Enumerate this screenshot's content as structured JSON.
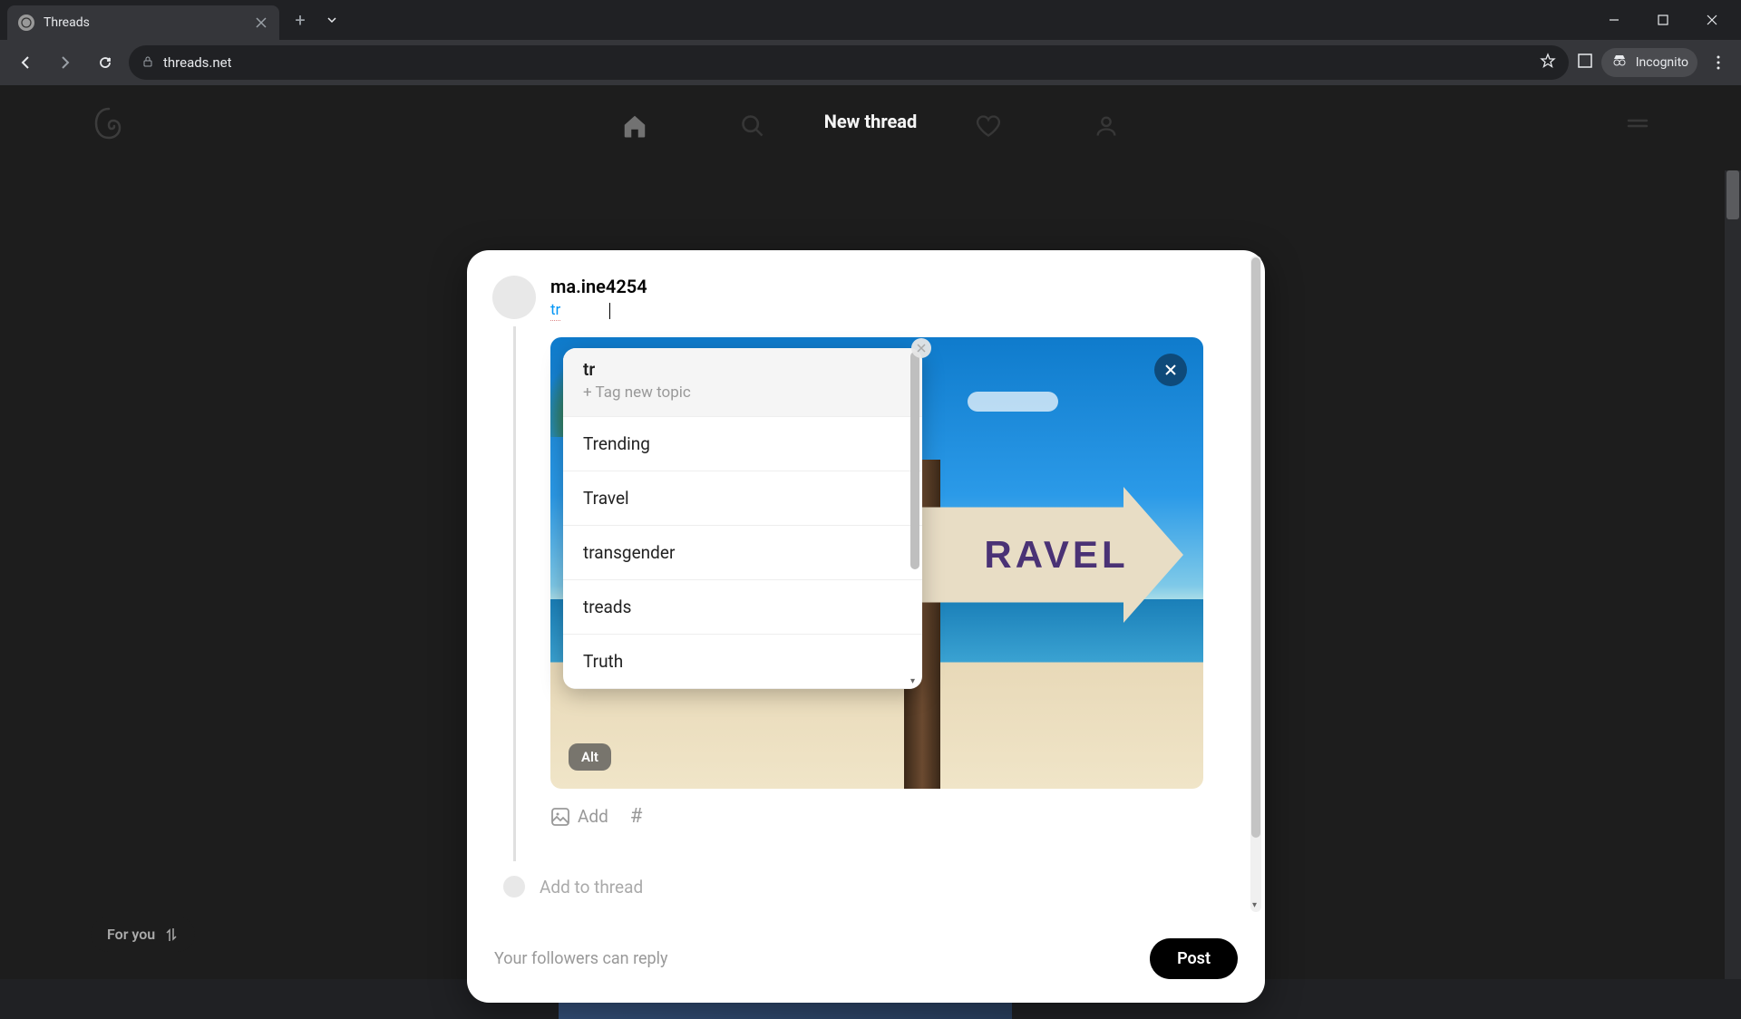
{
  "browser": {
    "tab_title": "Threads",
    "url": "threads.net",
    "incognito_label": "Incognito"
  },
  "threads_nav": {
    "modal_title": "New thread",
    "feed_pill": "For you"
  },
  "compose": {
    "username": "ma.ine4254",
    "typed_tag": "tr",
    "alt_label": "Alt",
    "add_label": "Add",
    "hash_label": "#",
    "add_to_thread": "Add to thread",
    "reply_setting": "Your followers can reply",
    "post_button": "Post",
    "image_sign_text": "RAVEL"
  },
  "topic_dropdown": {
    "query": "tr",
    "tag_new_label": "+ Tag new topic",
    "suggestions": [
      "Trending",
      "Travel",
      "transgender",
      "treads",
      "Truth"
    ]
  }
}
